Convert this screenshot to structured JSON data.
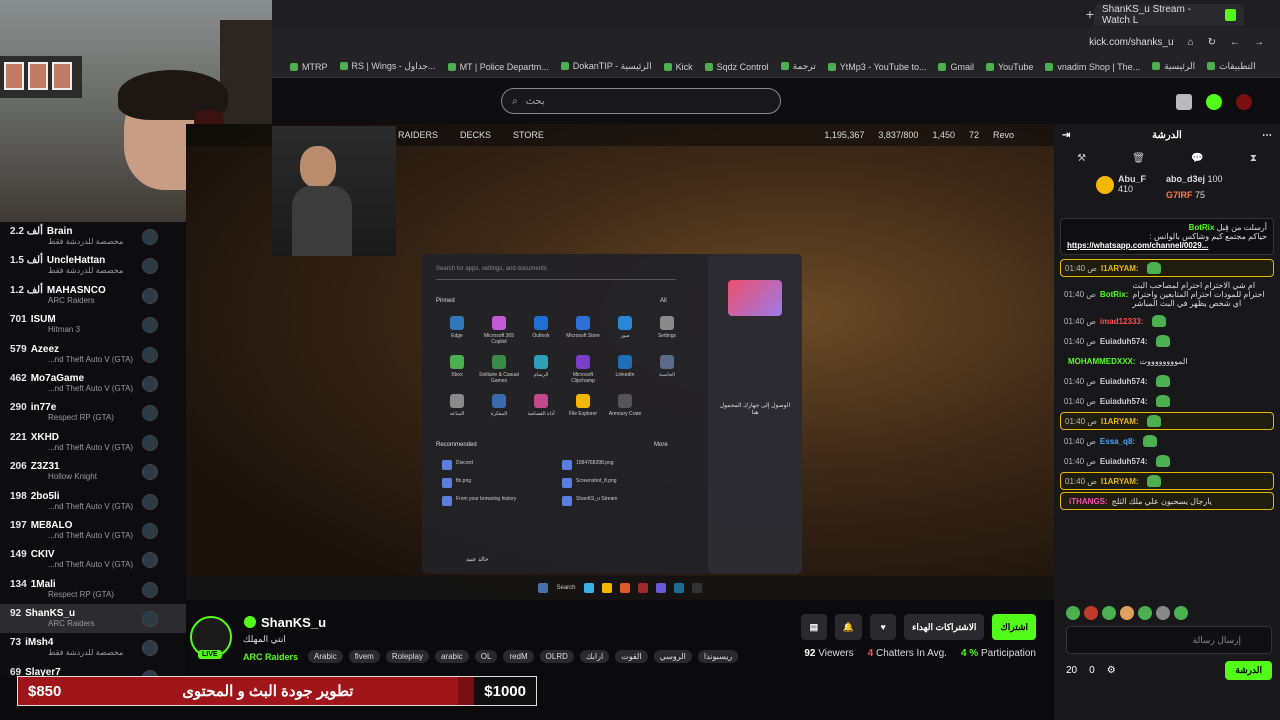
{
  "browser": {
    "tab_title": "ShanKS_u Stream - Watch L",
    "url": "kick.com/shanks_u",
    "bookmarks": [
      "التطبيقات",
      "الرئيسية",
      "vnadim Shop | The...",
      "YouTube",
      "Gmail",
      "YtMp3 - YouTube to...",
      "ترجمة",
      "Sqdz Control",
      "Kick",
      "DokanTIP - الرئيسية",
      "MT | Police Departm...",
      "RS | Wings - جداول...",
      "MTRP"
    ]
  },
  "kick": {
    "search_placeholder": "بحث"
  },
  "leaderboard": [
    {
      "points": "2.2 ألف",
      "name": "Brain",
      "sub": "مخصصة للدردشة فقط"
    },
    {
      "points": "1.5 ألف",
      "name": "UncleHattan",
      "sub": "مخصصة للدردشة فقط"
    },
    {
      "points": "1.2 ألف",
      "name": "MAHASNCO",
      "sub": "ARC Raiders"
    },
    {
      "points": "701",
      "name": "ISUM",
      "sub": "Hitman 3"
    },
    {
      "points": "579",
      "name": "Azeez",
      "sub": "...nd Theft Auto V (GTA)"
    },
    {
      "points": "462",
      "name": "Mo7aGame",
      "sub": "...nd Theft Auto V (GTA)"
    },
    {
      "points": "290",
      "name": "in77e",
      "sub": "Respect RP (GTA)"
    },
    {
      "points": "221",
      "name": "XKHD",
      "sub": "...nd Theft Auto V (GTA)"
    },
    {
      "points": "206",
      "name": "Z3Z31",
      "sub": "Hollow Knight"
    },
    {
      "points": "198",
      "name": "2bo5li",
      "sub": "...nd Theft Auto V (GTA)"
    },
    {
      "points": "197",
      "name": "ME8ALO",
      "sub": "...nd Theft Auto V (GTA)"
    },
    {
      "points": "149",
      "name": "CKIV",
      "sub": "...nd Theft Auto V (GTA)"
    },
    {
      "points": "134",
      "name": "1Mali",
      "sub": "Respect RP (GTA)"
    },
    {
      "points": "92",
      "name": "ShanKS_u",
      "sub": "ARC Raiders"
    },
    {
      "points": "73",
      "name": "iMsh4",
      "sub": "مخصصة للدردشة فقط"
    },
    {
      "points": "69",
      "name": "Slayer7",
      "sub": ""
    }
  ],
  "game": {
    "menu": [
      "RAIDERS",
      "DECKS",
      "STORE"
    ],
    "stats": [
      "1,195,367",
      "3,837/800",
      "1,450",
      "72",
      "Revo"
    ]
  },
  "startmenu": {
    "search": "Search for apps, settings, and documents",
    "pinned": "Pinned",
    "all": "All",
    "apps": [
      "Edge",
      "Microsoft 365 Copilot",
      "Outlook",
      "Microsoft Store",
      "صور",
      "Settings",
      "Xbox",
      "Solitaire & Casual Games",
      "الرسام",
      "Microsoft Clipchamp",
      "LinkedIn",
      "الحاسبة",
      "الساعة",
      "المفكرة",
      "أداة القصاصة",
      "File Explorer",
      "Armoury Crate"
    ],
    "recommended": "Recommended",
    "more": "More",
    "recs": [
      "Discord",
      "1584768398.png",
      "fbi.png",
      "Screenshot_8.png",
      "From your browsing history",
      "ShanKS_u Stream"
    ],
    "side_title": "الوصول إلى جهازك المحمول هنا",
    "user": "خالد عبيد"
  },
  "stream": {
    "name": "ShanKS_u",
    "title": "انتي المهلك",
    "category": "ARC Raiders",
    "tags": [
      "Arabic",
      "fivem",
      "Roleplay",
      "arabic",
      "OL",
      "redM",
      "OLRD",
      "ارابك",
      "القوت",
      "الروسي",
      "ريسبوندا"
    ],
    "live": "LIVE",
    "subscribe": "اشتراك",
    "gift_subs": "الاشتراكات الهداء",
    "viewers": "92",
    "viewers_label": "Viewers",
    "chatters": "4",
    "chatters_label": "Chatters In Avg.",
    "participation": "4 %",
    "participation_label": "Participation"
  },
  "goal": {
    "current": "$850",
    "title": "تطوير جودة البث و المحتوى",
    "target": "$1000",
    "progress": 0.85
  },
  "chat": {
    "title": "الدرشة",
    "leaders": [
      {
        "name": "Abu_F",
        "value": "410"
      },
      {
        "name": "abo_d3ej",
        "value": "100"
      },
      {
        "name": "G7IRF",
        "value": "75"
      }
    ],
    "pinned_by": "أرسلت من قِبل",
    "pinned_user": "BotRix",
    "pinned_text": "حياكم مجتمع كيم وشاكس بالواتس :",
    "pinned_link": "https://whatsapp.com/channel/0029...",
    "messages": [
      {
        "time": "01:40 ص",
        "user": "I1ARYAM:",
        "text": "",
        "color": "#e6b800",
        "hl": true
      },
      {
        "time": "01:40 ص",
        "user": "BotRix:",
        "text": "ام شي الاحترام احترام لمصاحب البث احترام للمودات احترام المتابعين واحترام اي شخص يظهر في البث المباشر",
        "color": "#53fc18",
        "hl": false
      },
      {
        "time": "01:40 ص",
        "user": "imad12333:",
        "text": "",
        "color": "#ff4d4d",
        "hl": false
      },
      {
        "time": "01:40 ص",
        "user": "Euiaduh574:",
        "text": "",
        "color": "#cfcfcf",
        "hl": false
      },
      {
        "time": "",
        "user": "MOHAMMEDXXX:",
        "text": "المووووووووت",
        "color": "#53fc18",
        "hl": false
      },
      {
        "time": "01:40 ص",
        "user": "Euiaduh574:",
        "text": "",
        "color": "#cfcfcf",
        "hl": false
      },
      {
        "time": "01:40 ص",
        "user": "Euiaduh574:",
        "text": "",
        "color": "#cfcfcf",
        "hl": false
      },
      {
        "time": "01:40 ص",
        "user": "I1ARYAM:",
        "text": "",
        "color": "#e6b800",
        "hl": true
      },
      {
        "time": "01:40 ص",
        "user": "Essa_q8:",
        "text": "",
        "color": "#4aa3ff",
        "hl": false
      },
      {
        "time": "01:40 ص",
        "user": "Euiaduh574:",
        "text": "",
        "color": "#cfcfcf",
        "hl": false
      },
      {
        "time": "01:40 ص",
        "user": "I1ARYAM:",
        "text": "",
        "color": "#e6b800",
        "hl": true
      },
      {
        "time": "",
        "user": "iTHANGS:",
        "text": "يارجال يسحبون علي ملك الثلج",
        "color": "#ff4db8",
        "hl": true
      }
    ],
    "input_placeholder": "إرسال رسالة",
    "points": "20",
    "count": "0",
    "send": "الدرشة"
  }
}
